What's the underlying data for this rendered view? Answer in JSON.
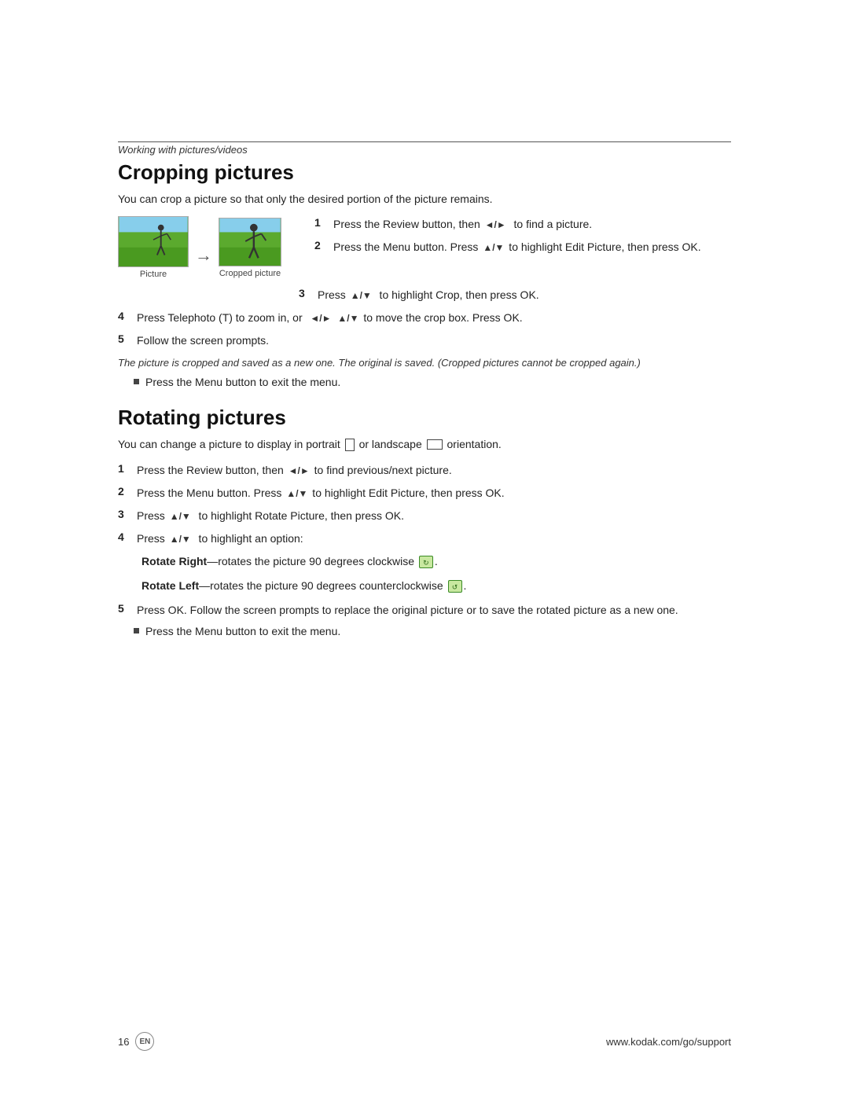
{
  "page": {
    "section_label": "Working with pictures/videos",
    "crop_section": {
      "title": "Cropping pictures",
      "intro": "You can crop a picture so that only the desired portion of the picture remains.",
      "image_labels": {
        "original": "Picture",
        "cropped": "Cropped picture"
      },
      "steps": [
        {
          "num": "1",
          "text": "Press the Review button, then",
          "icon_mid": "◄/►",
          "text2": " to find a picture."
        },
        {
          "num": "2",
          "text": "Press the Menu button. Press",
          "icon_mid": "▲/▼",
          "text2": " to highlight Edit Picture, then press OK."
        },
        {
          "num": "3",
          "text": "Press",
          "icon_mid": "▲/▼",
          "text2": " to highlight Crop, then press OK."
        },
        {
          "num": "4",
          "text": "Press Telephoto (T) to zoom in, or",
          "icon_mid": "◄/► ▲/▼",
          "text2": " to move the crop box. Press OK."
        },
        {
          "num": "5",
          "text": "Follow the screen prompts."
        }
      ],
      "note": "The picture is cropped and saved as a new one. The original is saved. (Cropped pictures cannot be cropped again.)",
      "bullet": "Press the Menu button to exit the menu."
    },
    "rotate_section": {
      "title": "Rotating pictures",
      "intro": "You can change a picture to display in portrait",
      "intro2": "or landscape",
      "intro3": "orientation.",
      "steps": [
        {
          "num": "1",
          "text": "Press the Review button, then",
          "icon_mid": "◄/►",
          "text2": " to find previous/next picture."
        },
        {
          "num": "2",
          "text": "Press the Menu button. Press",
          "icon_mid": "▲/▼",
          "text2": " to highlight Edit Picture, then press OK."
        },
        {
          "num": "3",
          "text": "Press",
          "icon_mid": "▲/▼",
          "text2": " to highlight Rotate Picture, then press OK."
        },
        {
          "num": "4",
          "text": "Press",
          "icon_mid": "▲/▼",
          "text2": " to highlight an option:"
        }
      ],
      "rotate_right": {
        "label": "Rotate Right",
        "dash": "—",
        "text": "rotates the picture 90 degrees clockwise"
      },
      "rotate_left": {
        "label": "Rotate Left",
        "dash": "—",
        "text": "rotates the picture 90 degrees counterclockwise"
      },
      "step5": {
        "num": "5",
        "text": "Press OK. Follow the screen prompts to replace the original picture or to save the rotated picture as a new one."
      },
      "bullet": "Press the Menu button to exit the menu."
    },
    "footer": {
      "page_num": "16",
      "en_label": "EN",
      "url": "www.kodak.com/go/support"
    }
  }
}
